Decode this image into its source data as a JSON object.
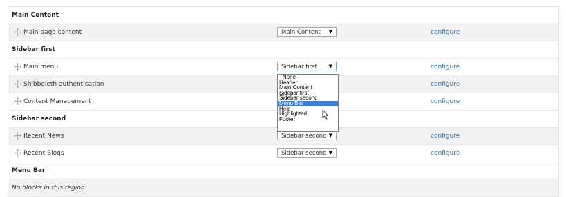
{
  "regions": {
    "main_content": {
      "title": "Main Content",
      "blocks": [
        {
          "label": "Main page content",
          "region_value": "Main Content",
          "action": "configure"
        }
      ]
    },
    "sidebar_first": {
      "title": "Sidebar first",
      "blocks": [
        {
          "label": "Main menu",
          "region_value": "Sidebar first",
          "action": "configure"
        },
        {
          "label": "Shibboleth authentication",
          "action": "configure"
        },
        {
          "label": "Content Management",
          "action": "configure"
        }
      ]
    },
    "sidebar_second": {
      "title": "Sidebar second",
      "blocks": [
        {
          "label": "Recent News",
          "region_value": "Sidebar second",
          "action": "configure"
        },
        {
          "label": "Recent Blogs",
          "region_value": "Sidebar second",
          "action": "configure"
        }
      ]
    },
    "menu_bar": {
      "title": "Menu Bar",
      "empty_text": "No blocks in this region"
    }
  },
  "dropdown": {
    "options": [
      "- None -",
      "Header",
      "Main Content",
      "Sidebar first",
      "Sidebar second",
      "Menu Bar",
      "Help",
      "Highlighted",
      "Footer"
    ],
    "highlighted": "Menu Bar"
  },
  "icons": {
    "drag": "drag-handle-icon",
    "select_arrow": "triangle-down-icon",
    "cursor": "mouse-pointer-icon"
  },
  "colors": {
    "link": "#2f76b8",
    "highlight": "#3b7cd5",
    "alt_row": "#f2f2f2"
  }
}
